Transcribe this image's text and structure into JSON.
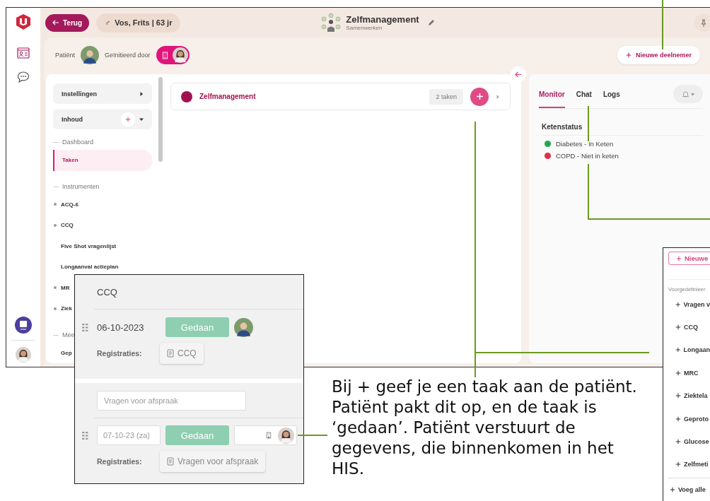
{
  "header": {
    "back_button": "Terug",
    "patient_chip": {
      "symbol": "♂",
      "text": "Vos, Frits | 63 jr"
    },
    "title": "Zelfmanagement",
    "subtitle": "Samenwerken"
  },
  "participants": {
    "patient_label": "Patiënt",
    "initiated_label": "Geïnitieerd door",
    "new_button": "Nieuwe deelnemer"
  },
  "sidebar": {
    "items": [
      {
        "kind": "group",
        "label": "Instellingen",
        "expanded": false,
        "addable": false
      },
      {
        "kind": "group",
        "label": "Inhoud",
        "expanded": true,
        "addable": true
      },
      {
        "kind": "section",
        "label": "Dashboard"
      },
      {
        "kind": "item",
        "label": "Taken",
        "selected": true,
        "bullet": false
      },
      {
        "kind": "section",
        "label": "Instrumenten"
      },
      {
        "kind": "item",
        "label": "ACQ-6",
        "selected": false,
        "bullet": true
      },
      {
        "kind": "item",
        "label": "CCQ",
        "selected": false,
        "bullet": true
      },
      {
        "kind": "item",
        "label": "Five Shot vragenlijst",
        "selected": false,
        "bullet": false
      },
      {
        "kind": "item",
        "label": "Longaanval actieplan",
        "selected": false,
        "bullet": false
      },
      {
        "kind": "item",
        "label": "MR",
        "selected": false,
        "bullet": true
      },
      {
        "kind": "item",
        "label": "Ziek",
        "selected": false,
        "bullet": true
      },
      {
        "kind": "section",
        "label": "Mee"
      },
      {
        "kind": "item",
        "label": "Gep",
        "selected": false,
        "bullet": false
      }
    ]
  },
  "task_card": {
    "title": "Zelfmanagement",
    "count": "2 taken"
  },
  "right_panel": {
    "tabs": [
      {
        "label": "Monitor",
        "selected": true
      },
      {
        "label": "Chat",
        "selected": false
      },
      {
        "label": "Logs",
        "selected": false
      }
    ],
    "heading": "Ketenstatus",
    "statuses": [
      {
        "label": "Diabetes - In Keten",
        "color": "#22a84a"
      },
      {
        "label": "COPD - Niet in keten",
        "color": "#dc3545"
      }
    ]
  },
  "task_detail": {
    "title": "CCQ",
    "date": "06-10-2023",
    "status_button": "Gedaan",
    "registrations_label": "Registraties:",
    "registration": "CCQ",
    "new_task": {
      "placeholder": "Vragen voor afspraak",
      "date": "07-10-23 (za)",
      "status_button": "Gedaan",
      "registrations_label": "Registraties:",
      "registration": "Vragen voor afspraak"
    }
  },
  "add_menu": {
    "new_button": "Nieuwe",
    "section": "Voorgedefinieer",
    "items": [
      "Vragen v",
      "CCQ",
      "Longaan",
      "MRC",
      "Ziektela",
      "Geproto",
      "Glucose",
      "Zelfmeti"
    ],
    "add_all": "Voeg alle"
  },
  "annotation": "Bij + geef je een taak aan de patiënt. Patiënt pakt dit op, en de taak is ‘gedaan’. Patiënt verstuurt de gegevens, die binnenkomen in het HIS."
}
